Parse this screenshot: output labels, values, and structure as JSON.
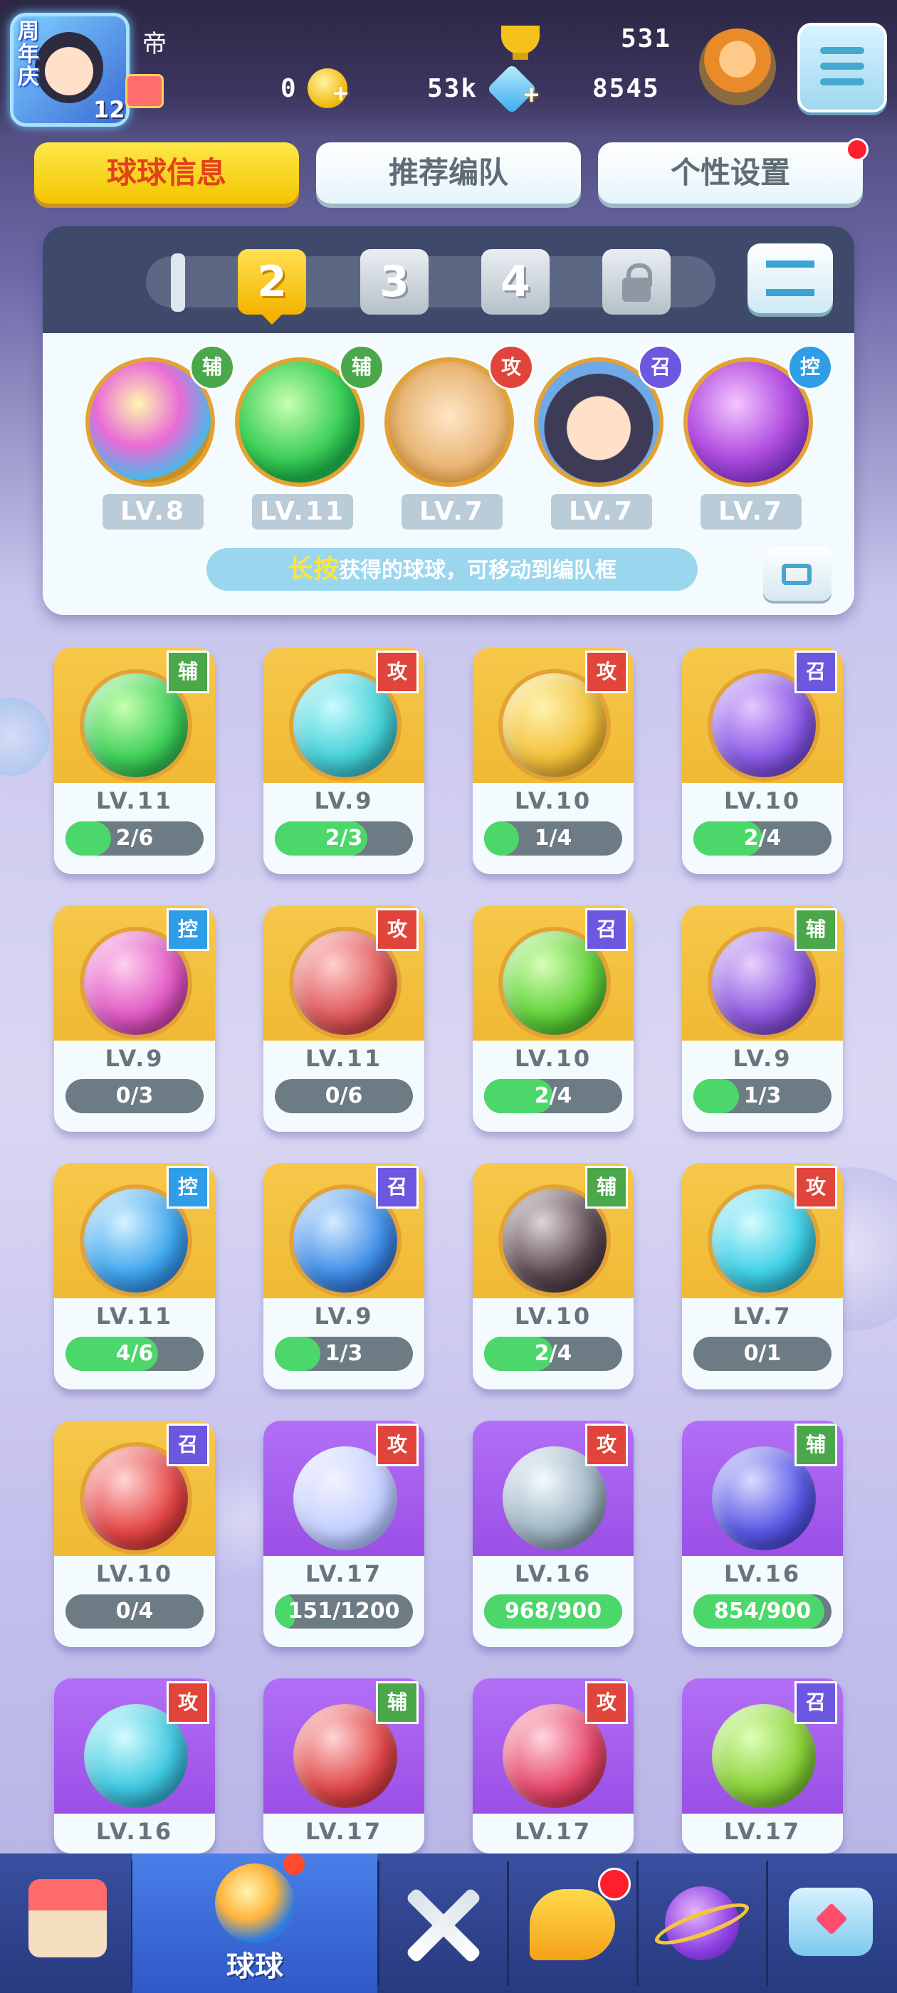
{
  "header": {
    "anniversary": "周年庆",
    "level": "12",
    "player_name": "帝",
    "trophy": "531",
    "coins": "0",
    "gems_left": "53k",
    "gems": "8545"
  },
  "tabs": [
    {
      "label": "球球信息",
      "active": true
    },
    {
      "label": "推荐编队",
      "active": false
    },
    {
      "label": "个性设置",
      "active": false
    }
  ],
  "team_panel": {
    "slots": [
      "2",
      "3",
      "4"
    ],
    "active_slot": "2",
    "team": [
      {
        "tag": "辅",
        "level": "LV.8"
      },
      {
        "tag": "辅",
        "level": "LV.11"
      },
      {
        "tag": "攻",
        "level": "LV.7"
      },
      {
        "tag": "召",
        "level": "LV.7"
      },
      {
        "tag": "控",
        "level": "LV.7"
      }
    ],
    "hint_highlight": "长按",
    "hint_text": "获得的球球，可移动到编队框"
  },
  "cards": [
    {
      "tag": "辅",
      "level": "LV.11",
      "progress": "2/6",
      "fill": 0.33
    },
    {
      "tag": "攻",
      "level": "LV.9",
      "progress": "2/3",
      "fill": 0.67
    },
    {
      "tag": "攻",
      "level": "LV.10",
      "progress": "1/4",
      "fill": 0.25
    },
    {
      "tag": "召",
      "level": "LV.10",
      "progress": "2/4",
      "fill": 0.5
    },
    {
      "tag": "控",
      "level": "LV.9",
      "progress": "0/3",
      "fill": 0
    },
    {
      "tag": "攻",
      "level": "LV.11",
      "progress": "0/6",
      "fill": 0
    },
    {
      "tag": "召",
      "level": "LV.10",
      "progress": "2/4",
      "fill": 0.5
    },
    {
      "tag": "辅",
      "level": "LV.9",
      "progress": "1/3",
      "fill": 0.33
    },
    {
      "tag": "控",
      "level": "LV.11",
      "progress": "4/6",
      "fill": 0.67
    },
    {
      "tag": "召",
      "level": "LV.9",
      "progress": "1/3",
      "fill": 0.33
    },
    {
      "tag": "辅",
      "level": "LV.10",
      "progress": "2/4",
      "fill": 0.5
    },
    {
      "tag": "攻",
      "level": "LV.7",
      "progress": "0/1",
      "fill": 0
    },
    {
      "tag": "召",
      "level": "LV.10",
      "progress": "0/4",
      "fill": 0
    },
    {
      "tag": "攻",
      "level": "LV.17",
      "progress": "151/1200",
      "fill": 0.13
    },
    {
      "tag": "攻",
      "level": "LV.16",
      "progress": "968/900",
      "fill": 1
    },
    {
      "tag": "辅",
      "level": "LV.16",
      "progress": "854/900",
      "fill": 0.95
    },
    {
      "tag": "攻",
      "level": "LV.16",
      "progress": "",
      "fill": 0
    },
    {
      "tag": "辅",
      "level": "LV.17",
      "progress": "",
      "fill": 0
    },
    {
      "tag": "攻",
      "level": "LV.17",
      "progress": "",
      "fill": 0
    },
    {
      "tag": "召",
      "level": "LV.17",
      "progress": "",
      "fill": 0
    }
  ],
  "bottom_nav": [
    {
      "icon": "shop-icon",
      "label": ""
    },
    {
      "icon": "ball-icon",
      "label": "球球",
      "active": true
    },
    {
      "icon": "crossed-swords-icon",
      "label": ""
    },
    {
      "icon": "whistle-icon",
      "label": ""
    },
    {
      "icon": "planet-icon",
      "label": ""
    },
    {
      "icon": "chat-heart-icon",
      "label": ""
    }
  ],
  "colors": {
    "tag_辅": "#4aa84a",
    "tag_攻": "#e0443a",
    "tag_召": "#6b57e0",
    "tag_控": "#2f9ee6",
    "tab_active_text": "#e2421a",
    "progress_fill": "#4bd76a"
  }
}
